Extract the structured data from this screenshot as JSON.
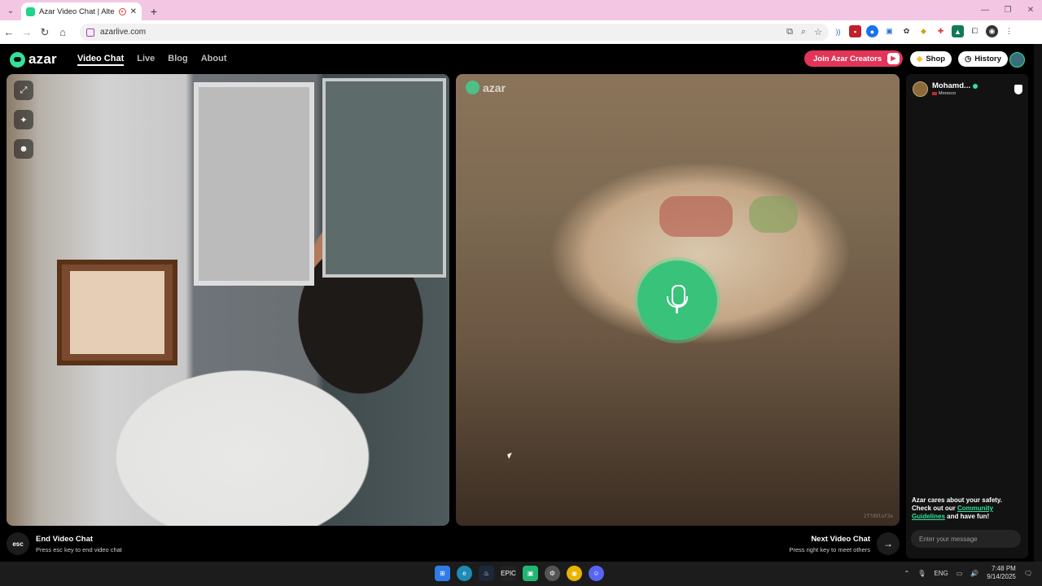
{
  "browser": {
    "tab_title": "Azar Video Chat | Alternati",
    "url": "azarlive.com",
    "new_tab": "+",
    "window_controls": [
      "—",
      "❐",
      "✕"
    ]
  },
  "site": {
    "logo_text": "azar",
    "nav": [
      {
        "label": "Video Chat",
        "active": true
      },
      {
        "label": "Live"
      },
      {
        "label": "Blog"
      },
      {
        "label": "About"
      }
    ],
    "join_creators": "Join Azar Creators",
    "shop": "Shop",
    "history": "History"
  },
  "video": {
    "watermark": "azar",
    "code": "2f7d9lof3e"
  },
  "controls": {
    "esc_key": "esc",
    "end_title": "End Video Chat",
    "end_hint": "Press esc key to end video chat",
    "next_title": "Next Video Chat",
    "next_hint": "Press right key to meet others"
  },
  "peer": {
    "name": "Mohamd...",
    "country": "Morocco"
  },
  "chat": {
    "safety_pre": "Azar cares about your safety. Check out our ",
    "safety_link": "Community Guidelines",
    "safety_post": " and have fun!",
    "placeholder": "Enter your message"
  },
  "taskbar": {
    "lang": "ENG",
    "time": "7:48 PM",
    "date": "9/14/2025"
  },
  "colors": {
    "accent": "#36e09a",
    "creators": "#e23558"
  }
}
